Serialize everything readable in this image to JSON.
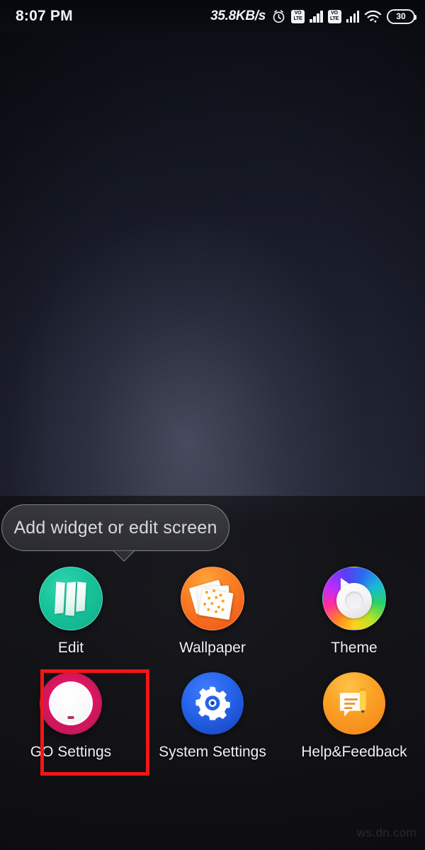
{
  "status_bar": {
    "time": "8:07 PM",
    "network_speed": "35.8KB/s",
    "alarm_icon": "alarm-clock-icon",
    "sim1_volte_line1": "VO",
    "sim1_volte_line2": "LTE",
    "sim1_signal_icon": "signal-bars-icon",
    "sim2_volte_line1": "VO",
    "sim2_volte_line2": "LTE",
    "sim2_signal_icon": "signal-bars-icon",
    "wifi_icon": "wifi-icon",
    "battery_level": "30",
    "battery_icon": "battery-icon"
  },
  "tooltip": {
    "text": "Add widget or edit screen"
  },
  "menu": {
    "rows": [
      [
        {
          "label": "Edit",
          "icon": "edit-pages-icon",
          "color": "#17c39a"
        },
        {
          "label": "Wallpaper",
          "icon": "wallpaper-photos-icon",
          "color": "#fb8024"
        },
        {
          "label": "Theme",
          "icon": "theme-color-wheel-icon",
          "color": "#c02dff"
        }
      ],
      [
        {
          "label": "GO Settings",
          "icon": "go-settings-dial-icon",
          "color": "#e51664"
        },
        {
          "label": "System Settings",
          "icon": "gear-icon",
          "color": "#2563e8"
        },
        {
          "label": "Help&Feedback",
          "icon": "help-feedback-icon",
          "color": "#fba125"
        }
      ]
    ]
  },
  "highlight": {
    "target_label": "GO Settings",
    "color": "#f21616"
  },
  "watermark": {
    "text": "ws.dn.com"
  }
}
